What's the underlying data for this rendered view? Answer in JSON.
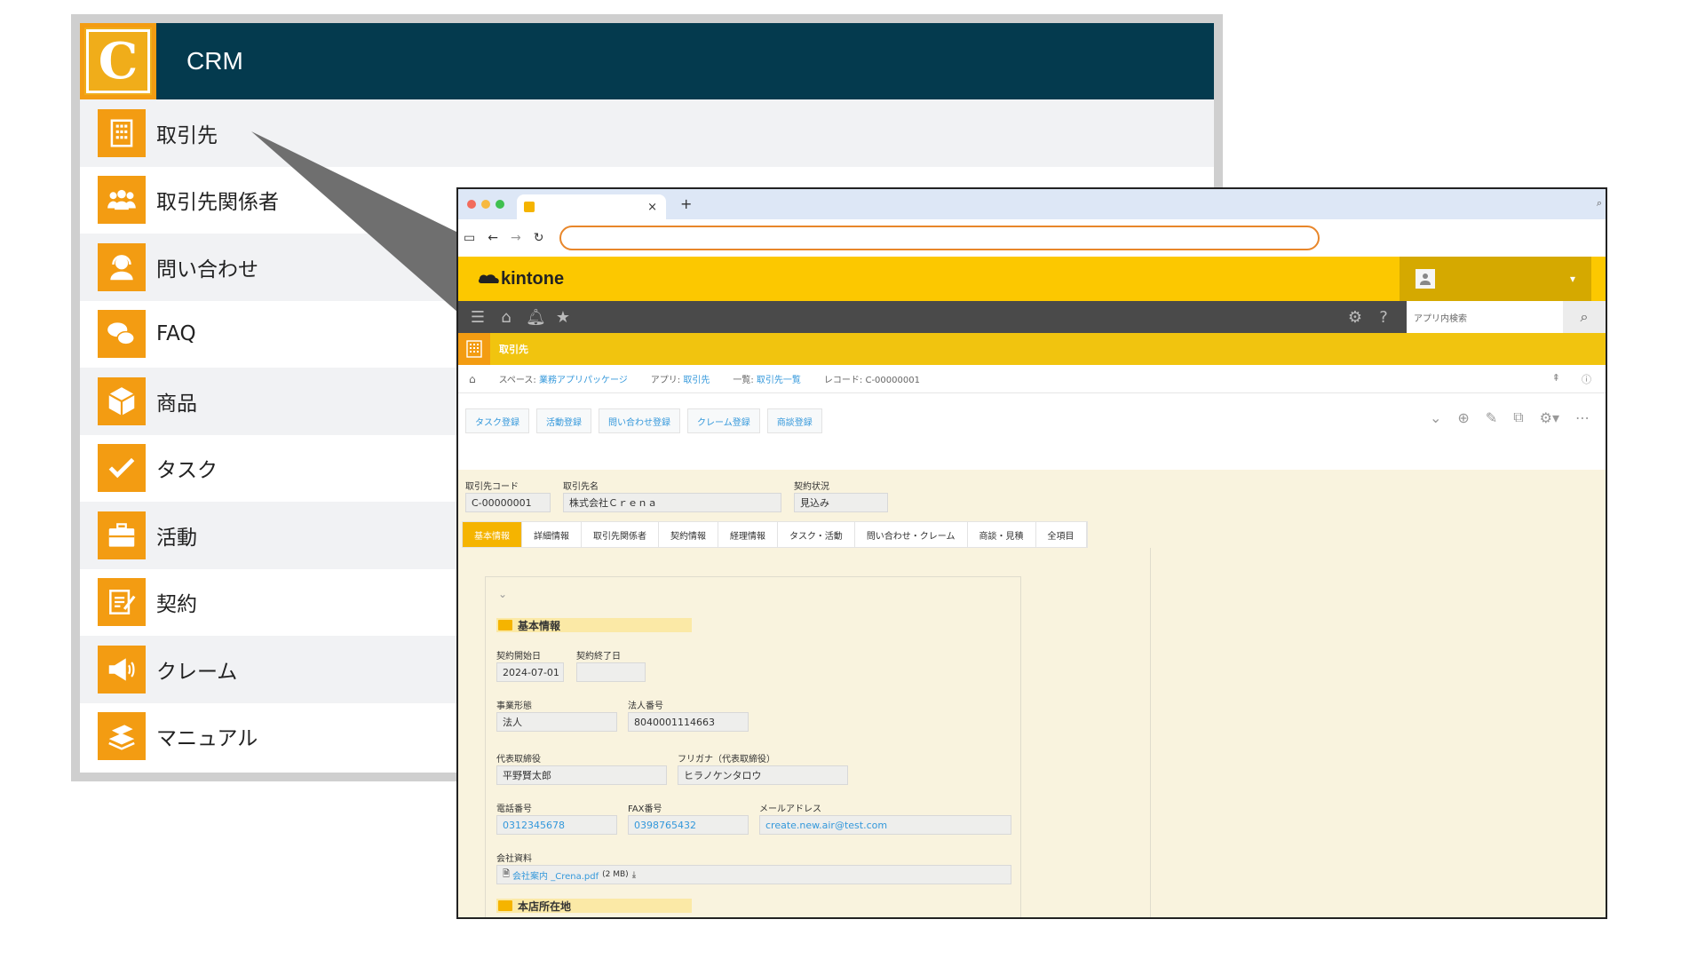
{
  "crm": {
    "logo_letter": "C",
    "title": "CRM",
    "items": [
      {
        "label": "取引先",
        "icon": "building-icon"
      },
      {
        "label": "取引先関係者",
        "icon": "people-icon"
      },
      {
        "label": "問い合わせ",
        "icon": "headset-icon"
      },
      {
        "label": "FAQ",
        "icon": "chat-icon"
      },
      {
        "label": "商品",
        "icon": "box-icon"
      },
      {
        "label": "タスク",
        "icon": "check-icon"
      },
      {
        "label": "活動",
        "icon": "briefcase-icon"
      },
      {
        "label": "契約",
        "icon": "contract-icon"
      },
      {
        "label": "クレーム",
        "icon": "megaphone-icon"
      },
      {
        "label": "マニュアル",
        "icon": "books-icon"
      }
    ],
    "colors": {
      "header": "#043a4e",
      "accent": "#f39c12"
    }
  },
  "browser": {
    "tab_close": "×",
    "tab_new": "+",
    "url": ""
  },
  "kintone": {
    "brand": "kintone",
    "search_placeholder": "アプリ内検索",
    "app_name": "取引先",
    "breadcrumb": {
      "space_label": "スペース:",
      "space": "業務アプリパッケージ",
      "app_label": "アプリ:",
      "app": "取引先",
      "list_label": "一覧:",
      "list": "取引先一覧",
      "record": "レコード: C-00000001"
    },
    "action_buttons": [
      "タスク登録",
      "活動登録",
      "問い合わせ登録",
      "クレーム登録",
      "商談登録"
    ],
    "colors": {
      "header": "#fcc800",
      "nav": "#4a4a4a",
      "app_bar": "#f1c40f",
      "link": "#3498db"
    }
  },
  "record": {
    "code_label": "取引先コード",
    "code": "C-00000001",
    "name_label": "取引先名",
    "name": "株式会社Ｃｒｅｎａ",
    "status_label": "契約状況",
    "status": "見込み",
    "tabs": [
      "基本情報",
      "詳細情報",
      "取引先関係者",
      "契約情報",
      "経理情報",
      "タスク・活動",
      "問い合わせ・クレーム",
      "商談・見積",
      "全項目"
    ],
    "active_tab": 0,
    "section_basic": "基本情報",
    "contract_start_label": "契約開始日",
    "contract_start": "2024-07-01",
    "contract_end_label": "契約終了日",
    "contract_end": "",
    "business_type_label": "事業形態",
    "business_type": "法人",
    "corp_number_label": "法人番号",
    "corp_number": "8040001114663",
    "rep_label": "代表取締役",
    "rep": "平野賢太郎",
    "rep_kana_label": "フリガナ（代表取締役）",
    "rep_kana": "ヒラノケンタロウ",
    "tel_label": "電話番号",
    "tel": "0312345678",
    "fax_label": "FAX番号",
    "fax": "0398765432",
    "email_label": "メールアドレス",
    "email": "create.new.air@test.com",
    "docs_label": "会社資料",
    "doc_file": "会社案内 _Crena.pdf",
    "doc_size": "(2 MB)",
    "section_hq": "本店所在地"
  }
}
